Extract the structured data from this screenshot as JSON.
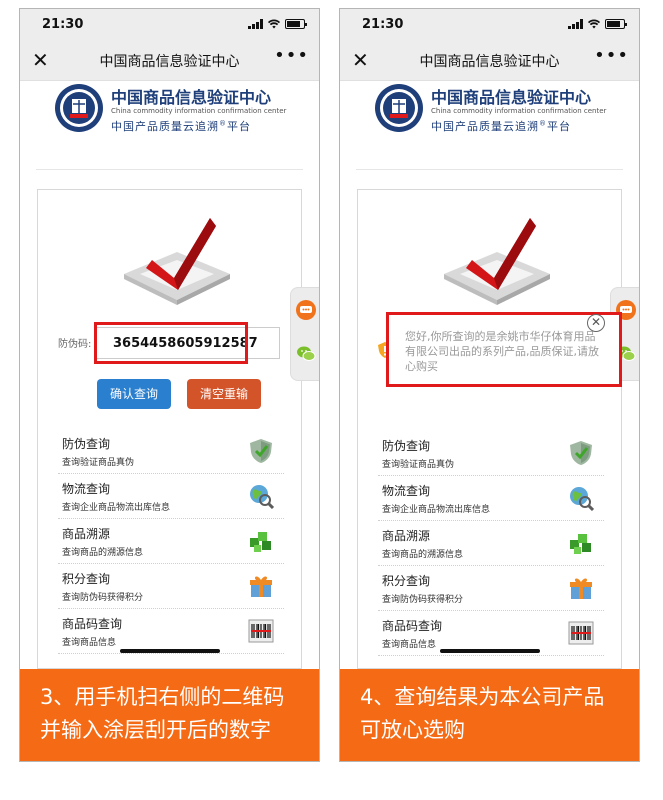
{
  "status_bar": {
    "time": "21:30"
  },
  "nav": {
    "title": "中国商品信息验证中心",
    "close_glyph": "✕",
    "more_glyph": "•••"
  },
  "logo": {
    "cn_name": "中国商品信息验证中心",
    "en_name": "China commodity information confirmation center",
    "subtitle_a": "中国产品质量云追溯",
    "subtitle_mark": "®",
    "subtitle_b": "平台"
  },
  "form": {
    "label": "防伪码:",
    "code_value": "3654458605912587",
    "query_button": "确认查询",
    "clear_button": "清空重输"
  },
  "services": [
    {
      "title": "防伪查询",
      "desc": "查询验证商品真伪",
      "icon": "shield-check-icon"
    },
    {
      "title": "物流查询",
      "desc": "查询企业商品物流出库信息",
      "icon": "globe-search-icon"
    },
    {
      "title": "商品溯源",
      "desc": "查询商品的溯源信息",
      "icon": "cubes-icon"
    },
    {
      "title": "积分查询",
      "desc": "查询防伪码获得积分",
      "icon": "gift-icon"
    },
    {
      "title": "商品码查询",
      "desc": "查询商品信息",
      "icon": "barcode-icon"
    }
  ],
  "popup": {
    "message": "您好,你所查询的是余姚市华仔体育用品有限公司出品的系列产品,品质保证,请放心购买",
    "close_glyph": "✕"
  },
  "captions": {
    "step3_line1": "3、用手机扫右侧的二维码",
    "step3_line2": "并输入涂层刮开后的数字",
    "step4_line1": "4、查询结果为本公司产品",
    "step4_line2": "可放心选购"
  },
  "colors": {
    "caption_bg": "#f56a14",
    "query_button": "#2a7fcf",
    "clear_button": "#d4542a",
    "highlight": "#e0191b",
    "logo_text": "#1f3f7a"
  }
}
